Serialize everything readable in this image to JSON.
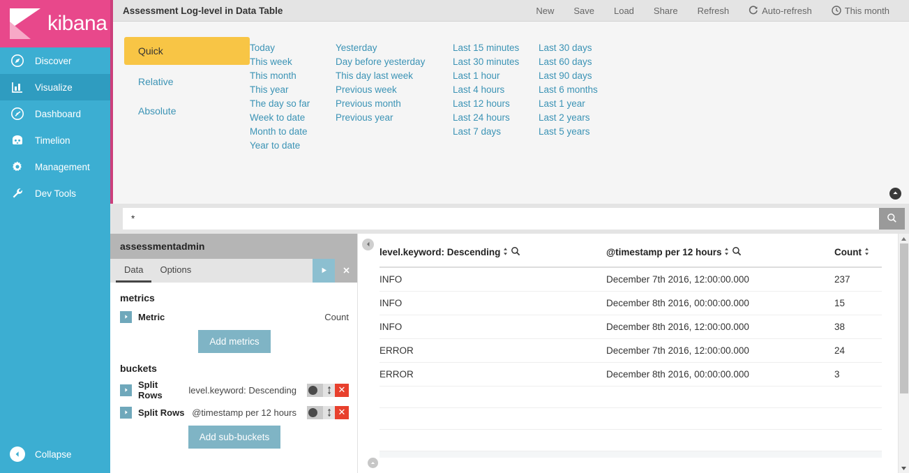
{
  "brand": {
    "name": "kibana",
    "logo_icon": "kibana-logo",
    "pink": "#e8488b",
    "teal": "#3caed2"
  },
  "sidebar": {
    "items": [
      {
        "label": "Discover",
        "icon": "compass-icon",
        "active": false
      },
      {
        "label": "Visualize",
        "icon": "bar-chart-icon",
        "active": true
      },
      {
        "label": "Dashboard",
        "icon": "dashboard-gauge-icon",
        "active": false
      },
      {
        "label": "Timelion",
        "icon": "timelion-icon",
        "active": false
      },
      {
        "label": "Management",
        "icon": "gear-icon",
        "active": false
      },
      {
        "label": "Dev Tools",
        "icon": "wrench-icon",
        "active": false
      }
    ],
    "collapse_label": "Collapse",
    "collapse_icon": "chevron-left-circle-icon"
  },
  "header": {
    "title": "Assessment Log-level in Data Table",
    "actions": [
      {
        "label": "New",
        "icon": null
      },
      {
        "label": "Save",
        "icon": null
      },
      {
        "label": "Load",
        "icon": null
      },
      {
        "label": "Share",
        "icon": null
      },
      {
        "label": "Refresh",
        "icon": null
      },
      {
        "label": "Auto-refresh",
        "icon": "refresh-icon"
      },
      {
        "label": "This month",
        "icon": "clock-icon"
      }
    ]
  },
  "timepicker": {
    "modes": [
      {
        "label": "Quick",
        "active": true
      },
      {
        "label": "Relative",
        "active": false
      },
      {
        "label": "Absolute",
        "active": false
      }
    ],
    "columns": [
      [
        "Today",
        "This week",
        "This month",
        "This year",
        "The day so far",
        "Week to date",
        "Month to date",
        "Year to date"
      ],
      [
        "Yesterday",
        "Day before yesterday",
        "This day last week",
        "Previous week",
        "Previous month",
        "Previous year"
      ],
      [
        "Last 15 minutes",
        "Last 30 minutes",
        "Last 1 hour",
        "Last 4 hours",
        "Last 12 hours",
        "Last 24 hours",
        "Last 7 days"
      ],
      [
        "Last 30 days",
        "Last 60 days",
        "Last 90 days",
        "Last 6 months",
        "Last 1 year",
        "Last 2 years",
        "Last 5 years"
      ]
    ],
    "collapse_icon": "chevron-up-circle-icon"
  },
  "query": {
    "value": "*",
    "placeholder": "",
    "submit_icon": "search-icon"
  },
  "config": {
    "index_pattern": "assessmentadmin",
    "tabs": [
      {
        "label": "Data",
        "active": true
      },
      {
        "label": "Options",
        "active": false
      }
    ],
    "apply_icon": "play-icon",
    "discard_icon": "close-icon",
    "metrics_title": "metrics",
    "metrics": [
      {
        "label": "Metric",
        "value": "Count"
      }
    ],
    "add_metrics_label": "Add metrics",
    "buckets_title": "buckets",
    "buckets": [
      {
        "label": "Split Rows",
        "value": "level.keyword: Descending"
      },
      {
        "label": "Split Rows",
        "value": "@timestamp per 12 hours"
      }
    ],
    "add_buckets_label": "Add sub-buckets",
    "toggle_icon": "toggle-switch-icon",
    "sort_icon": "up-down-arrow-icon",
    "delete_icon": "remove-x-icon"
  },
  "visualization": {
    "collapse_icon": "chevron-left-circle-icon",
    "expand_icon": "chevron-up-circle-icon",
    "sort_icon": "sort-updown-icon",
    "filter_icon": "magnifier-icon",
    "columns": [
      "level.keyword: Descending",
      "@timestamp per 12 hours",
      "Count"
    ],
    "rows": [
      {
        "level": "INFO",
        "timestamp": "December 7th 2016, 12:00:00.000",
        "count": "237"
      },
      {
        "level": "INFO",
        "timestamp": "December 8th 2016, 00:00:00.000",
        "count": "15"
      },
      {
        "level": "INFO",
        "timestamp": "December 8th 2016, 12:00:00.000",
        "count": "38"
      },
      {
        "level": "ERROR",
        "timestamp": "December 7th 2016, 12:00:00.000",
        "count": "24"
      },
      {
        "level": "ERROR",
        "timestamp": "December 8th 2016, 00:00:00.000",
        "count": "3"
      }
    ],
    "empty_row_count": 3
  },
  "chart_data": {
    "type": "table",
    "title": "Assessment Log-level in Data Table",
    "columns": [
      "level.keyword: Descending",
      "@timestamp per 12 hours",
      "Count"
    ],
    "rows": [
      [
        "INFO",
        "December 7th 2016, 12:00:00.000",
        237
      ],
      [
        "INFO",
        "December 8th 2016, 00:00:00.000",
        15
      ],
      [
        "INFO",
        "December 8th 2016, 12:00:00.000",
        38
      ],
      [
        "ERROR",
        "December 7th 2016, 12:00:00.000",
        24
      ],
      [
        "ERROR",
        "December 8th 2016, 00:00:00.000",
        3
      ]
    ],
    "metric": "Count",
    "buckets": [
      "level.keyword: Descending",
      "@timestamp per 12 hours"
    ],
    "index_pattern": "assessmentadmin",
    "query": "*",
    "time_range": "This month"
  },
  "scrollbar": {
    "up_icon": "triangle-up-icon",
    "down_icon": "triangle-down-icon"
  }
}
